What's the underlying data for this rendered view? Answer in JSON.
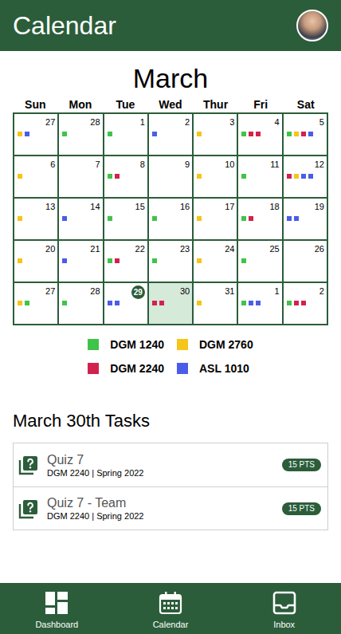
{
  "header": {
    "title": "Calendar"
  },
  "calendar": {
    "month": "March",
    "weekdays": [
      "Sun",
      "Mon",
      "Tue",
      "Wed",
      "Thur",
      "Fri",
      "Sat"
    ],
    "days": [
      {
        "day": "27",
        "today": false,
        "selected": false,
        "dots": [
          {
            "color": "#f5c518"
          },
          {
            "color": "#4a5de8"
          }
        ]
      },
      {
        "day": "28",
        "today": false,
        "selected": false,
        "dots": [
          {
            "color": "#3fc44a"
          }
        ]
      },
      {
        "day": "1",
        "today": false,
        "selected": false,
        "dots": [
          {
            "color": "#3fc44a"
          }
        ]
      },
      {
        "day": "2",
        "today": false,
        "selected": false,
        "dots": [
          {
            "color": "#4a5de8"
          }
        ]
      },
      {
        "day": "3",
        "today": false,
        "selected": false,
        "dots": [
          {
            "color": "#f5c518"
          }
        ]
      },
      {
        "day": "4",
        "today": false,
        "selected": false,
        "dots": [
          {
            "color": "#3fc44a"
          },
          {
            "color": "#d3214f"
          },
          {
            "color": "#d3214f"
          }
        ]
      },
      {
        "day": "5",
        "today": false,
        "selected": false,
        "dots": [
          {
            "color": "#3fc44a"
          },
          {
            "color": "#f5c518"
          },
          {
            "color": "#d3214f"
          },
          {
            "color": "#4a5de8"
          }
        ]
      },
      {
        "day": "6",
        "today": false,
        "selected": false,
        "dots": [
          {
            "color": "#f5c518"
          }
        ]
      },
      {
        "day": "7",
        "today": false,
        "selected": false,
        "dots": []
      },
      {
        "day": "8",
        "today": false,
        "selected": false,
        "dots": [
          {
            "color": "#3fc44a"
          },
          {
            "color": "#d3214f"
          }
        ]
      },
      {
        "day": "9",
        "today": false,
        "selected": false,
        "dots": []
      },
      {
        "day": "10",
        "today": false,
        "selected": false,
        "dots": [
          {
            "color": "#f5c518"
          }
        ]
      },
      {
        "day": "11",
        "today": false,
        "selected": false,
        "dots": [
          {
            "color": "#3fc44a"
          }
        ]
      },
      {
        "day": "12",
        "today": false,
        "selected": false,
        "dots": [
          {
            "color": "#d3214f"
          },
          {
            "color": "#f5c518"
          },
          {
            "color": "#4a5de8"
          },
          {
            "color": "#4a5de8"
          }
        ]
      },
      {
        "day": "13",
        "today": false,
        "selected": false,
        "dots": [
          {
            "color": "#f5c518"
          }
        ]
      },
      {
        "day": "14",
        "today": false,
        "selected": false,
        "dots": [
          {
            "color": "#4a5de8"
          }
        ]
      },
      {
        "day": "15",
        "today": false,
        "selected": false,
        "dots": [
          {
            "color": "#3fc44a"
          }
        ]
      },
      {
        "day": "16",
        "today": false,
        "selected": false,
        "dots": [
          {
            "color": "#3fc44a"
          }
        ]
      },
      {
        "day": "17",
        "today": false,
        "selected": false,
        "dots": [
          {
            "color": "#f5c518"
          }
        ]
      },
      {
        "day": "18",
        "today": false,
        "selected": false,
        "dots": [
          {
            "color": "#3fc44a"
          },
          {
            "color": "#d3214f"
          }
        ]
      },
      {
        "day": "19",
        "today": false,
        "selected": false,
        "dots": [
          {
            "color": "#4a5de8"
          },
          {
            "color": "#4a5de8"
          }
        ]
      },
      {
        "day": "20",
        "today": false,
        "selected": false,
        "dots": [
          {
            "color": "#f5c518"
          }
        ]
      },
      {
        "day": "21",
        "today": false,
        "selected": false,
        "dots": [
          {
            "color": "#4a5de8"
          }
        ]
      },
      {
        "day": "22",
        "today": false,
        "selected": false,
        "dots": [
          {
            "color": "#3fc44a"
          },
          {
            "color": "#d3214f"
          }
        ]
      },
      {
        "day": "23",
        "today": false,
        "selected": false,
        "dots": [
          {
            "color": "#3fc44a"
          }
        ]
      },
      {
        "day": "24",
        "today": false,
        "selected": false,
        "dots": [
          {
            "color": "#f5c518"
          }
        ]
      },
      {
        "day": "25",
        "today": false,
        "selected": false,
        "dots": [
          {
            "color": "#3fc44a"
          }
        ]
      },
      {
        "day": "26",
        "today": false,
        "selected": false,
        "dots": []
      },
      {
        "day": "27",
        "today": false,
        "selected": false,
        "dots": [
          {
            "color": "#f5c518"
          },
          {
            "color": "#3fc44a"
          }
        ]
      },
      {
        "day": "28",
        "today": false,
        "selected": false,
        "dots": [
          {
            "color": "#3fc44a"
          }
        ]
      },
      {
        "day": "29",
        "today": true,
        "selected": false,
        "dots": [
          {
            "color": "#4a5de8"
          },
          {
            "color": "#4a5de8"
          }
        ]
      },
      {
        "day": "30",
        "today": false,
        "selected": true,
        "dots": [
          {
            "color": "#d3214f"
          },
          {
            "color": "#d3214f"
          }
        ]
      },
      {
        "day": "31",
        "today": false,
        "selected": false,
        "dots": [
          {
            "color": "#f5c518"
          }
        ]
      },
      {
        "day": "1",
        "today": false,
        "selected": false,
        "dots": [
          {
            "color": "#3fc44a"
          },
          {
            "color": "#4a5de8"
          },
          {
            "color": "#4a5de8"
          }
        ]
      },
      {
        "day": "2",
        "today": false,
        "selected": false,
        "dots": [
          {
            "color": "#3fc44a"
          },
          {
            "color": "#d3214f"
          },
          {
            "color": "#d3214f"
          }
        ]
      }
    ]
  },
  "legend": [
    {
      "label": "DGM 1240",
      "color": "#3fc44a"
    },
    {
      "label": "DGM 2760",
      "color": "#f5c518"
    },
    {
      "label": "DGM 2240",
      "color": "#d3214f"
    },
    {
      "label": "ASL 1010",
      "color": "#4a5de8"
    }
  ],
  "tasks": {
    "heading": "March 30th Tasks",
    "items": [
      {
        "title": "Quiz 7",
        "subtitle": "DGM 2240 | Spring 2022",
        "points": "15 PTS"
      },
      {
        "title": "Quiz 7 - Team",
        "subtitle": "DGM 2240 | Spring 2022",
        "points": "15 PTS"
      }
    ]
  },
  "nav": [
    {
      "label": "Dashboard"
    },
    {
      "label": "Calendar"
    },
    {
      "label": "Inbox"
    }
  ]
}
